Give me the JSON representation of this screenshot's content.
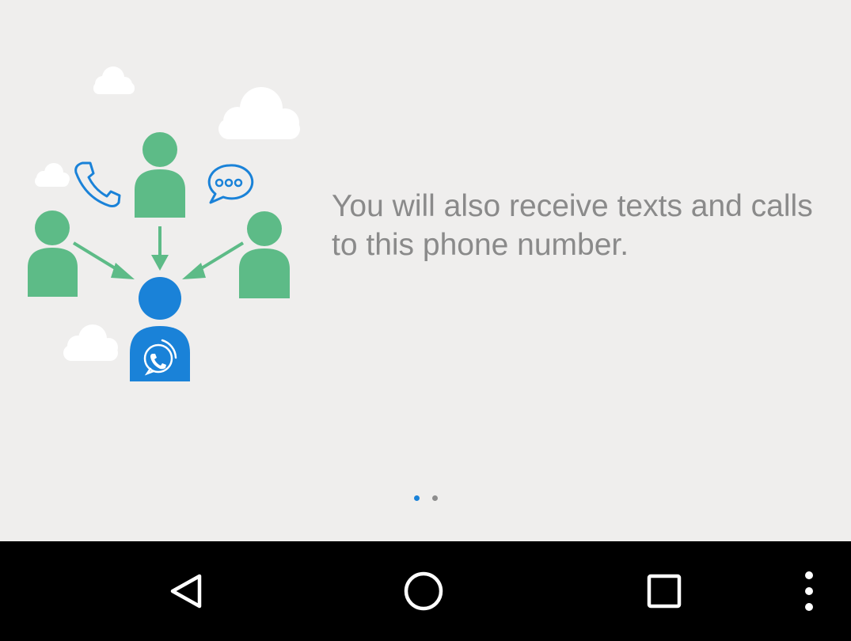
{
  "onboarding": {
    "message": "You will also receive texts and calls to this phone number.",
    "page_indicator": {
      "total": 2,
      "current": 1
    },
    "colors": {
      "accent": "#1a82d8",
      "person_green": "#5dbb87",
      "person_blue": "#1a82d8",
      "cloud": "#ffffff",
      "text": "#8a8a8a",
      "background": "#efeeed"
    },
    "icons": [
      "phone-icon",
      "chat-bubble-icon",
      "cloud-icon",
      "person-icon",
      "app-logo-icon"
    ]
  },
  "navbar": {
    "back": "back-icon",
    "home": "home-icon",
    "recents": "recents-icon",
    "menu": "overflow-menu-icon"
  }
}
